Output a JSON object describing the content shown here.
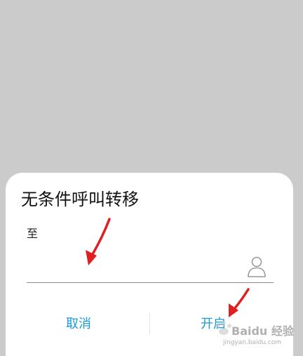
{
  "dialog": {
    "title": "无条件呼叫转移",
    "to_label": "至",
    "number_value": "",
    "cancel_label": "取消",
    "confirm_label": "开启"
  },
  "watermark": {
    "brand": "Baidu 经验",
    "sub": "jingyan.baidu.com"
  },
  "colors": {
    "scrim": "#cbcbcb",
    "dialog_bg": "#ffffff",
    "button_text": "#1a9ad6",
    "annotation_arrow": "#e02020"
  },
  "icons": {
    "contact_picker": "person-outline-icon",
    "annotation": "red-arrow-icon"
  }
}
